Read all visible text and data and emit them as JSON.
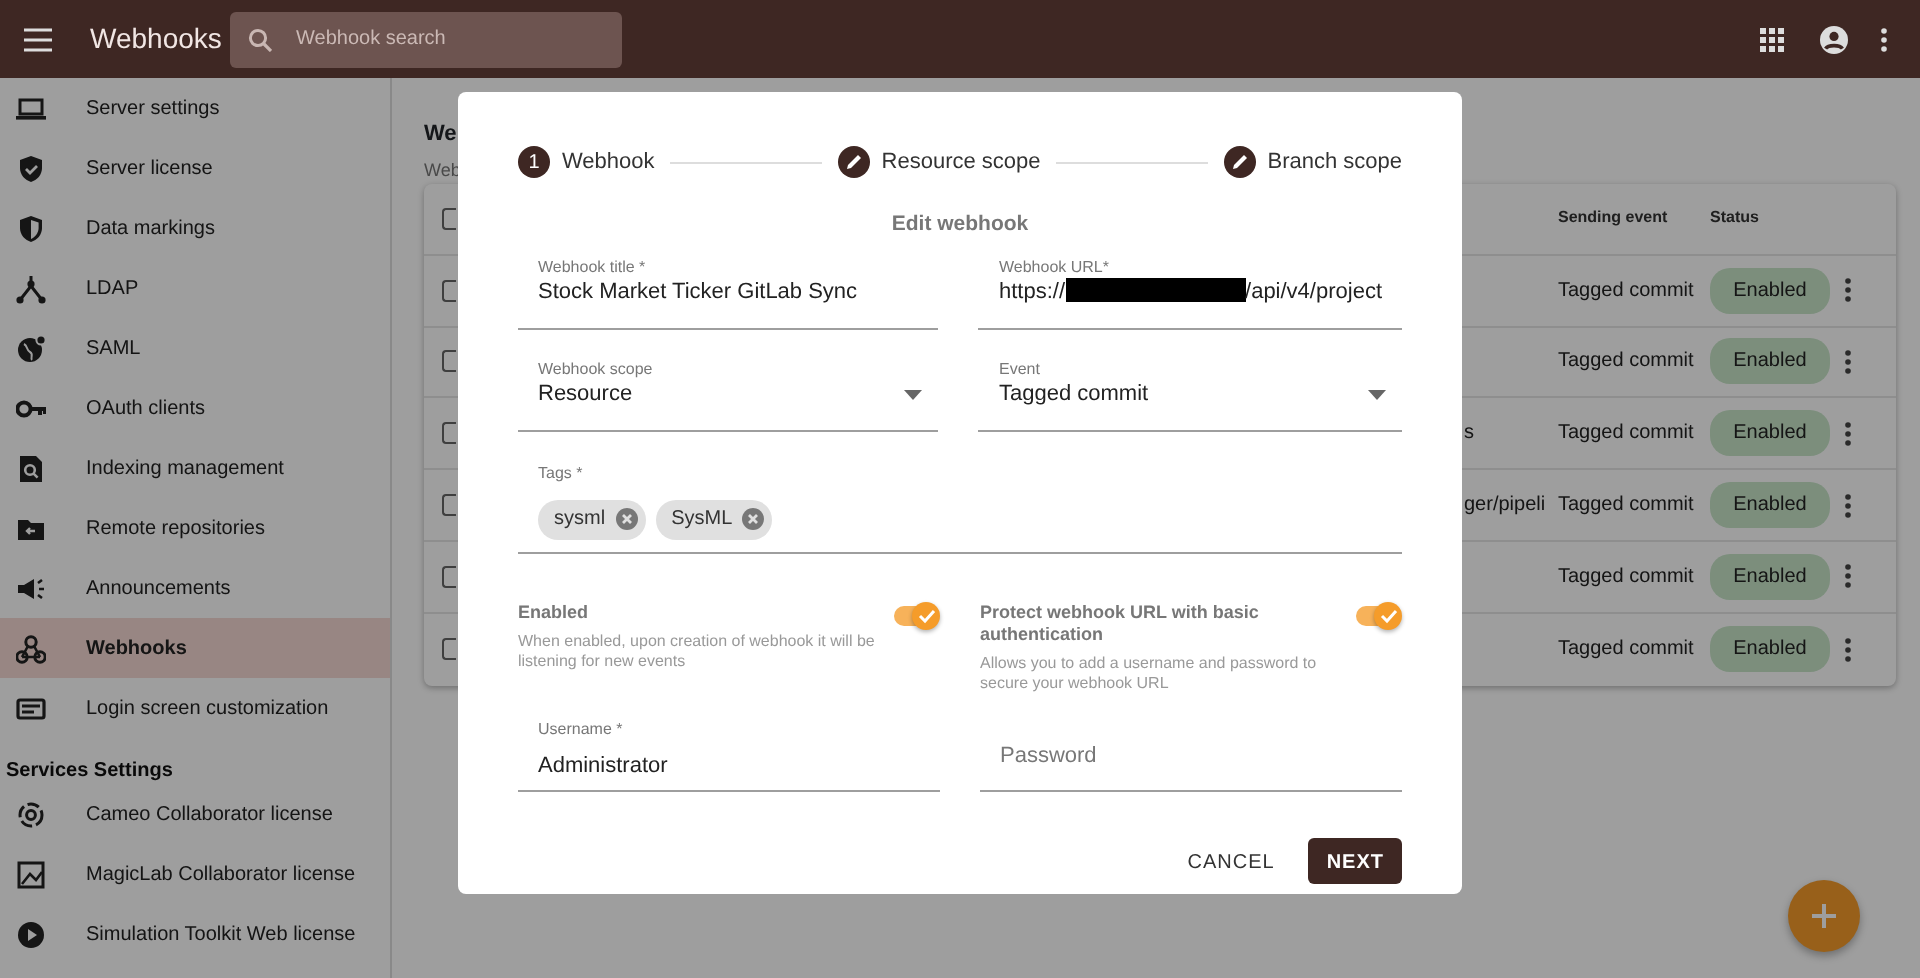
{
  "topbar": {
    "title": "Webhooks",
    "search_placeholder": "Webhook search"
  },
  "sidebar": {
    "items": [
      {
        "kind": "item",
        "label": "Server settings",
        "selected": false
      },
      {
        "kind": "item",
        "label": "Server license",
        "selected": false
      },
      {
        "kind": "item",
        "label": "Data markings",
        "selected": false
      },
      {
        "kind": "item",
        "label": "LDAP",
        "selected": false
      },
      {
        "kind": "item",
        "label": "SAML",
        "selected": false
      },
      {
        "kind": "item",
        "label": "OAuth clients",
        "selected": false
      },
      {
        "kind": "item",
        "label": "Indexing management",
        "selected": false
      },
      {
        "kind": "item",
        "label": "Remote repositories",
        "selected": false
      },
      {
        "kind": "item",
        "label": "Announcements",
        "selected": false
      },
      {
        "kind": "item",
        "label": "Webhooks",
        "selected": true
      },
      {
        "kind": "item",
        "label": "Login screen customization",
        "selected": false
      },
      {
        "kind": "header",
        "label": "Services Settings"
      },
      {
        "kind": "item",
        "label": "Cameo Collaborator license",
        "selected": false
      },
      {
        "kind": "item",
        "label": "MagicLab Collaborator license",
        "selected": false
      },
      {
        "kind": "item",
        "label": "Simulation Toolkit Web license",
        "selected": false
      }
    ]
  },
  "page": {
    "heading": "We",
    "subheading": "Web",
    "table": {
      "header_checked": false,
      "columns": [
        "Sending event",
        "Status"
      ],
      "rows": [
        {
          "checked": false,
          "event": "Tagged commit",
          "status": "Enabled"
        },
        {
          "checked": false,
          "event": "Tagged commit",
          "status": "Enabled"
        },
        {
          "checked": false,
          "fragment": "s",
          "event": "Tagged commit",
          "status": "Enabled"
        },
        {
          "checked": false,
          "fragment": "ger/pipeli",
          "event": "Tagged commit",
          "status": "Enabled"
        },
        {
          "checked": false,
          "event": "Tagged commit",
          "status": "Enabled"
        },
        {
          "checked": false,
          "event": "Tagged commit",
          "status": "Enabled"
        }
      ]
    }
  },
  "dialog": {
    "steps": [
      {
        "kind": "number",
        "number": "1",
        "label": "Webhook"
      },
      {
        "kind": "edit",
        "label": "Resource scope"
      },
      {
        "kind": "edit",
        "label": "Branch scope"
      }
    ],
    "title": "Edit webhook",
    "fields": [
      {
        "kind": "text",
        "label": "Webhook title *",
        "value": "Stock Market Ticker GitLab Sync"
      },
      {
        "kind": "redacted",
        "label": "Webhook URL*",
        "value_before": "https://",
        "value_after": "/api/v4/project"
      },
      {
        "kind": "select",
        "label": "Webhook scope",
        "value": "Resource"
      },
      {
        "kind": "select",
        "label": "Event",
        "value": "Tagged commit"
      }
    ],
    "tags": {
      "label": "Tags *",
      "chips": [
        "sysml",
        "SysML"
      ]
    },
    "toggles": [
      {
        "title": "Enabled",
        "description": "When enabled, upon creation of webhook it will be listening for new events",
        "on": true
      },
      {
        "title": "Protect webhook URL with basic authentication",
        "description": "Allows you to add a username and password to secure your webhook URL",
        "on": true
      }
    ],
    "credentials": [
      {
        "label": "Username *",
        "value": "Administrator"
      },
      {
        "placeholder": "Password"
      }
    ],
    "buttons": [
      {
        "kind": "text",
        "label": "CANCEL"
      },
      {
        "kind": "primary",
        "label": "NEXT"
      }
    ]
  }
}
